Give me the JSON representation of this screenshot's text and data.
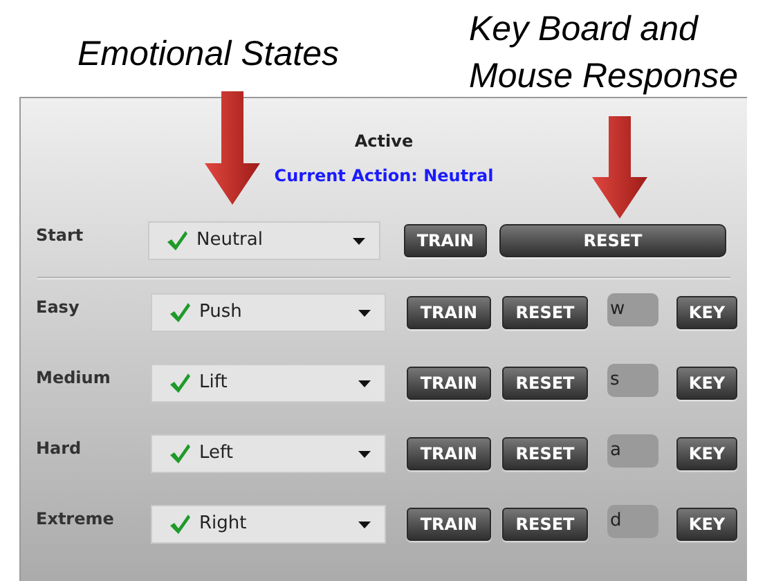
{
  "annotations": [
    {
      "text": "Emotional States"
    },
    {
      "text": "Key Board and Mouse Response"
    }
  ],
  "panel": {
    "status": "Active",
    "current_action": "Current Action: Neutral",
    "start": {
      "label": "Start",
      "action": "Neutral",
      "trained": true,
      "train_button": "TRAIN",
      "reset_button": "RESET"
    },
    "levels": [
      {
        "label": "Easy",
        "action": "Push",
        "trained": true,
        "train_button": "TRAIN",
        "reset_button": "RESET",
        "key": "w",
        "key_button": "KEY"
      },
      {
        "label": "Medium",
        "action": "Lift",
        "trained": true,
        "train_button": "TRAIN",
        "reset_button": "RESET",
        "key": "s",
        "key_button": "KEY"
      },
      {
        "label": "Hard",
        "action": "Left",
        "trained": true,
        "train_button": "TRAIN",
        "reset_button": "RESET",
        "key": "a",
        "key_button": "KEY"
      },
      {
        "label": "Extreme",
        "action": "Right",
        "trained": true,
        "train_button": "TRAIN",
        "reset_button": "RESET",
        "key": "d",
        "key_button": "KEY"
      }
    ]
  }
}
